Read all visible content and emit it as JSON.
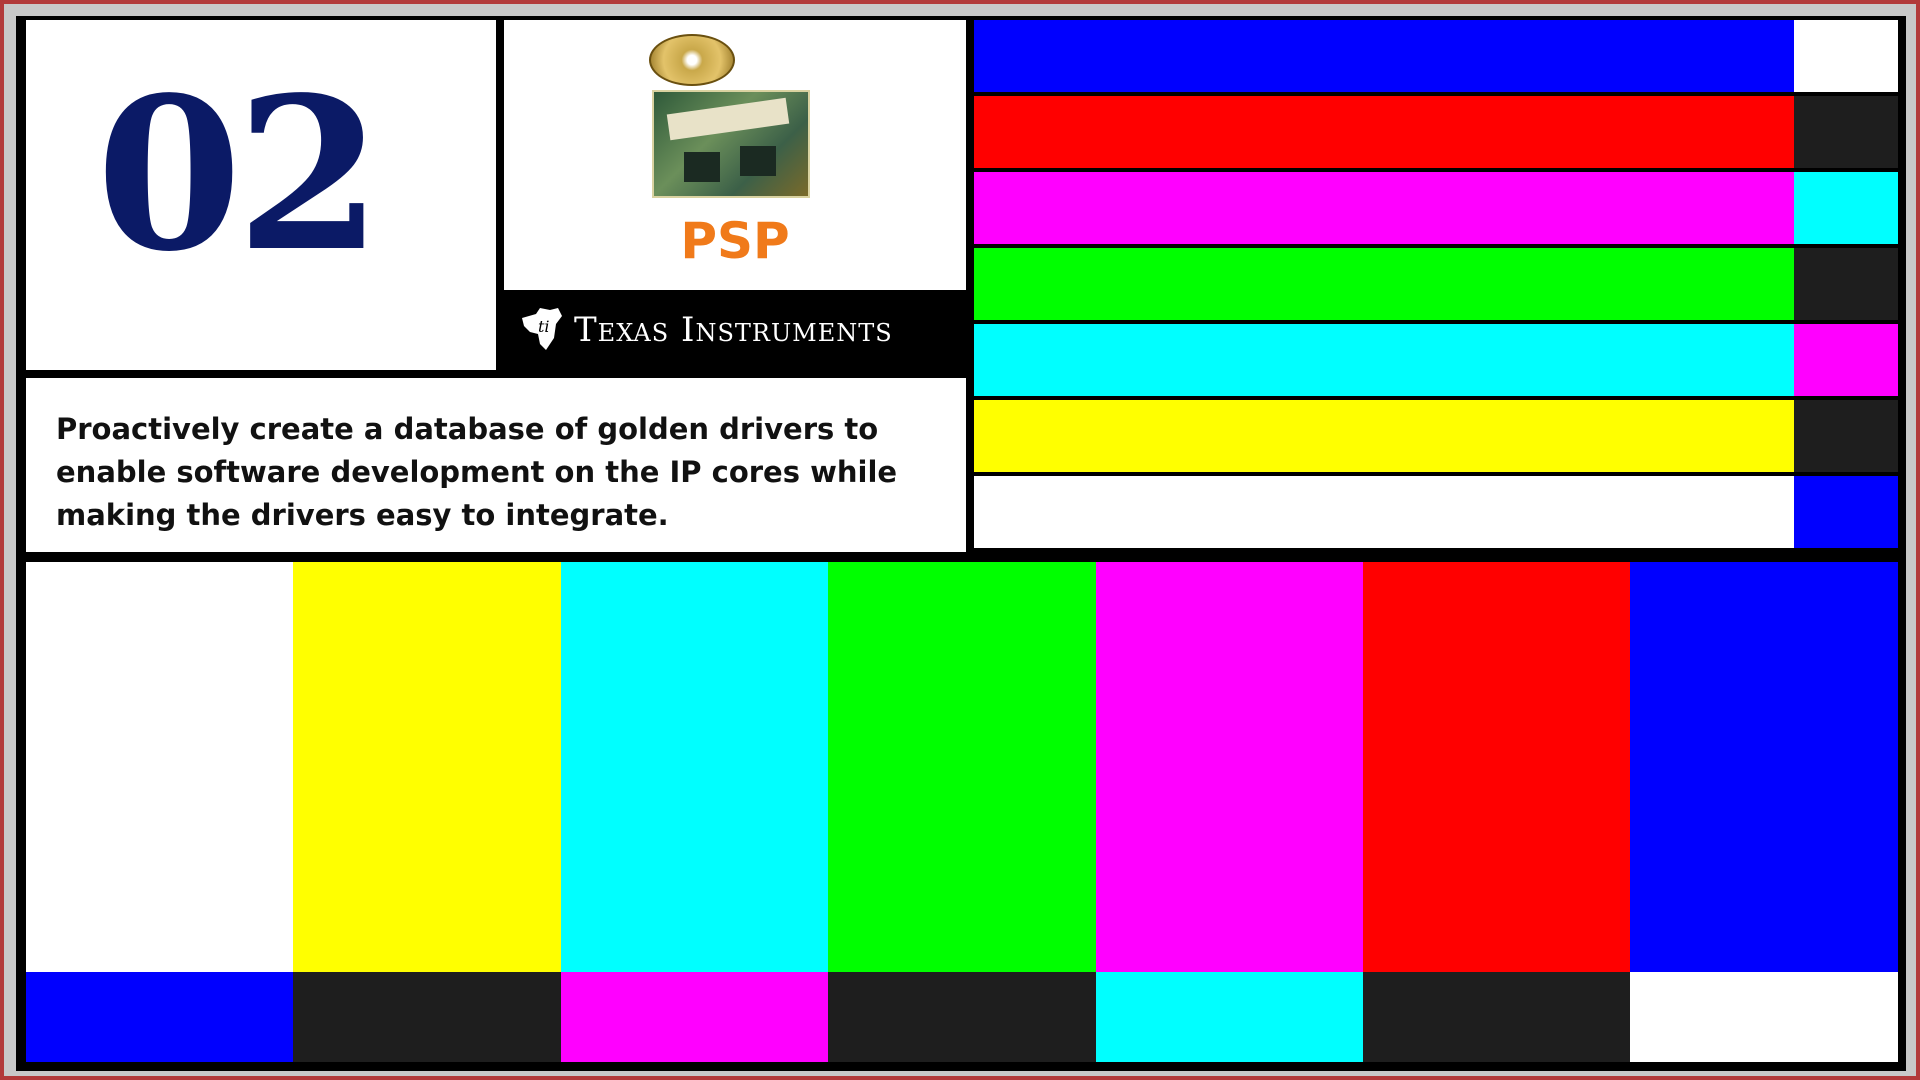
{
  "slide": {
    "number": "02",
    "product": "PSP",
    "brand": "Texas Instruments",
    "description": "Proactively create a database of golden drivers to enable software development on the IP cores while making the drivers easy to integrate."
  },
  "colors": {
    "number": "#0b1a66",
    "product": "#f07a1a",
    "frame_border": "#b23a3a"
  },
  "icons": [
    "ti-logo-icon",
    "cd-disc-icon",
    "circuit-board-icon"
  ],
  "color_bars": {
    "horizontal": [
      {
        "main": "#0000ff",
        "side": "#ffffff"
      },
      {
        "main": "#ff0000",
        "side": "#1e1e1e"
      },
      {
        "main": "#ff00ff",
        "side": "#00ffff"
      },
      {
        "main": "#00ff00",
        "side": "#1e1e1e"
      },
      {
        "main": "#00ffff",
        "side": "#ff00ff"
      },
      {
        "main": "#ffff00",
        "side": "#1e1e1e"
      },
      {
        "main": "#ffffff",
        "side": "#0000ff"
      }
    ],
    "vertical": [
      {
        "top": "#ffffff",
        "bottom": "#0000ff"
      },
      {
        "top": "#ffff00",
        "bottom": "#1e1e1e"
      },
      {
        "top": "#00ffff",
        "bottom": "#ff00ff"
      },
      {
        "top": "#00ff00",
        "bottom": "#1e1e1e"
      },
      {
        "top": "#ff00ff",
        "bottom": "#00ffff"
      },
      {
        "top": "#ff0000",
        "bottom": "#1e1e1e"
      },
      {
        "top": "#0000ff",
        "bottom": "#ffffff"
      }
    ]
  }
}
